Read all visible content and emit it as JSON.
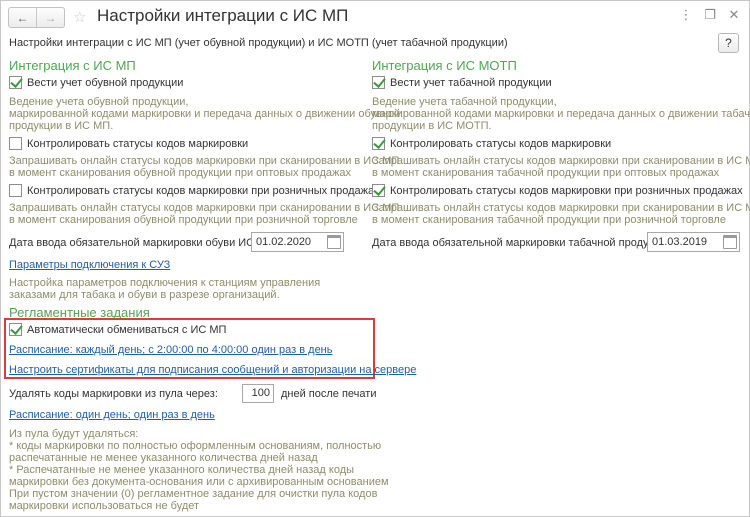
{
  "titlebar": {
    "back_icon": "←",
    "forward_icon": "→",
    "star_icon": "☆",
    "title": "Настройки интеграции с ИС МП",
    "more_icon": "⋮",
    "restore_icon": "❐",
    "close_icon": "✕"
  },
  "subtitle": "Настройки интеграции с ИС МП (учет обувной продукции) и ИС МОТП (учет табачной продукции)",
  "help_label": "?",
  "left": {
    "heading": "Интеграция с ИС МП",
    "keep_records": {
      "label": "Вести учет обувной продукции",
      "checked": true
    },
    "keep_records_hint": [
      "Ведение учета обувной продукции,",
      "маркированной кодами маркировки и передача данных о движении обувной",
      "продукции в ИС МП."
    ],
    "control_status": {
      "label": "Контролировать статусы кодов маркировки",
      "checked": false
    },
    "control_status_hint": [
      "Запрашивать онлайн статусы кодов маркировки при сканировании в ИС МП",
      "в момент сканирования обувной продукции при оптовых продажах"
    ],
    "control_retail": {
      "label": "Контролировать статусы кодов маркировки при розничных продажах",
      "checked": false
    },
    "control_retail_hint": [
      "Запрашивать онлайн статусы кодов маркировки при сканировании в ИС МП",
      "в момент сканирования обувной продукции при розничной торговле"
    ],
    "date_label": "Дата ввода обязательной маркировки обуви ИС МП:",
    "date_value": "01.02.2020"
  },
  "right": {
    "heading": "Интеграция с ИС МОТП",
    "keep_records": {
      "label": "Вести учет табачной продукции",
      "checked": true
    },
    "keep_records_hint": [
      "Ведение учета табачной продукции,",
      "маркированной кодами маркировки и передача данных о движении табачной",
      "продукции в ИС МОТП."
    ],
    "control_status": {
      "label": "Контролировать статусы кодов маркировки",
      "checked": true
    },
    "control_status_hint": [
      "Запрашивать онлайн статусы кодов маркировки при сканировании в ИС МОТП",
      "в момент сканирования табачной продукции при оптовых продажах"
    ],
    "control_retail": {
      "label": "Контролировать статусы кодов маркировки при розничных продажах",
      "checked": true
    },
    "control_retail_hint": [
      "Запрашивать онлайн статусы кодов маркировки при сканировании в ИС МОТП",
      "в момент сканирования табачной продукции при розничной торговле"
    ],
    "date_label": "Дата ввода обязательной маркировки табачной продукции:",
    "date_value": "01.03.2019"
  },
  "suz": {
    "link": "Параметры подключения к СУЗ",
    "hint": [
      "Настройка параметров подключения к станциям управления",
      "заказами для табака и обуви в разрезе организаций."
    ]
  },
  "scheduled": {
    "heading": "Регламентные задания",
    "auto_exchange": {
      "label": "Автоматически обмениваться с ИС МП",
      "checked": true
    },
    "schedule_link": "Расписание: каждый день; с 2:00:00 по 4:00:00 один раз в день",
    "certificates_link": "Настроить сертификаты для подписания сообщений и авторизации на сервере",
    "delete_label": "Удалять коды маркировки из пула через:",
    "delete_days": "100",
    "delete_suffix": "дней после печати",
    "pool_schedule_link": "Расписание: один день; один раз в день",
    "pool_hint": [
      "Из пула будут удаляться:",
      " * коды маркировки по полностью оформленным основаниям, полностью",
      "распечатанные не менее указанного количества дней назад",
      " * Распечатанные не менее указанного количества дней назад коды",
      "маркировки без документа-основания или с архивированным основанием",
      "При пустом значении (0) регламентное задание для очистки пула кодов",
      "маркировки использоваться не будет"
    ]
  },
  "colors": {
    "section_heading": "#4fa74f",
    "hint_text": "#8d8d6a",
    "link": "#1f5fa8",
    "highlight": "#e03b3b"
  }
}
